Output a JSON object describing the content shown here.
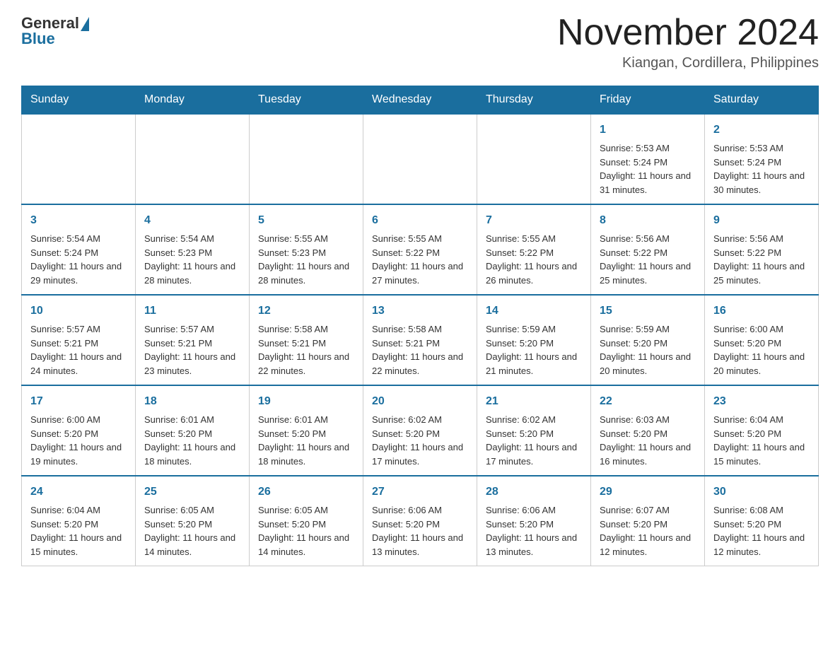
{
  "header": {
    "logo": {
      "general": "General",
      "blue": "Blue"
    },
    "title": "November 2024",
    "location": "Kiangan, Cordillera, Philippines"
  },
  "days_of_week": [
    "Sunday",
    "Monday",
    "Tuesday",
    "Wednesday",
    "Thursday",
    "Friday",
    "Saturday"
  ],
  "weeks": [
    [
      {
        "day": "",
        "info": ""
      },
      {
        "day": "",
        "info": ""
      },
      {
        "day": "",
        "info": ""
      },
      {
        "day": "",
        "info": ""
      },
      {
        "day": "",
        "info": ""
      },
      {
        "day": "1",
        "info": "Sunrise: 5:53 AM\nSunset: 5:24 PM\nDaylight: 11 hours and 31 minutes."
      },
      {
        "day": "2",
        "info": "Sunrise: 5:53 AM\nSunset: 5:24 PM\nDaylight: 11 hours and 30 minutes."
      }
    ],
    [
      {
        "day": "3",
        "info": "Sunrise: 5:54 AM\nSunset: 5:24 PM\nDaylight: 11 hours and 29 minutes."
      },
      {
        "day": "4",
        "info": "Sunrise: 5:54 AM\nSunset: 5:23 PM\nDaylight: 11 hours and 28 minutes."
      },
      {
        "day": "5",
        "info": "Sunrise: 5:55 AM\nSunset: 5:23 PM\nDaylight: 11 hours and 28 minutes."
      },
      {
        "day": "6",
        "info": "Sunrise: 5:55 AM\nSunset: 5:22 PM\nDaylight: 11 hours and 27 minutes."
      },
      {
        "day": "7",
        "info": "Sunrise: 5:55 AM\nSunset: 5:22 PM\nDaylight: 11 hours and 26 minutes."
      },
      {
        "day": "8",
        "info": "Sunrise: 5:56 AM\nSunset: 5:22 PM\nDaylight: 11 hours and 25 minutes."
      },
      {
        "day": "9",
        "info": "Sunrise: 5:56 AM\nSunset: 5:22 PM\nDaylight: 11 hours and 25 minutes."
      }
    ],
    [
      {
        "day": "10",
        "info": "Sunrise: 5:57 AM\nSunset: 5:21 PM\nDaylight: 11 hours and 24 minutes."
      },
      {
        "day": "11",
        "info": "Sunrise: 5:57 AM\nSunset: 5:21 PM\nDaylight: 11 hours and 23 minutes."
      },
      {
        "day": "12",
        "info": "Sunrise: 5:58 AM\nSunset: 5:21 PM\nDaylight: 11 hours and 22 minutes."
      },
      {
        "day": "13",
        "info": "Sunrise: 5:58 AM\nSunset: 5:21 PM\nDaylight: 11 hours and 22 minutes."
      },
      {
        "day": "14",
        "info": "Sunrise: 5:59 AM\nSunset: 5:20 PM\nDaylight: 11 hours and 21 minutes."
      },
      {
        "day": "15",
        "info": "Sunrise: 5:59 AM\nSunset: 5:20 PM\nDaylight: 11 hours and 20 minutes."
      },
      {
        "day": "16",
        "info": "Sunrise: 6:00 AM\nSunset: 5:20 PM\nDaylight: 11 hours and 20 minutes."
      }
    ],
    [
      {
        "day": "17",
        "info": "Sunrise: 6:00 AM\nSunset: 5:20 PM\nDaylight: 11 hours and 19 minutes."
      },
      {
        "day": "18",
        "info": "Sunrise: 6:01 AM\nSunset: 5:20 PM\nDaylight: 11 hours and 18 minutes."
      },
      {
        "day": "19",
        "info": "Sunrise: 6:01 AM\nSunset: 5:20 PM\nDaylight: 11 hours and 18 minutes."
      },
      {
        "day": "20",
        "info": "Sunrise: 6:02 AM\nSunset: 5:20 PM\nDaylight: 11 hours and 17 minutes."
      },
      {
        "day": "21",
        "info": "Sunrise: 6:02 AM\nSunset: 5:20 PM\nDaylight: 11 hours and 17 minutes."
      },
      {
        "day": "22",
        "info": "Sunrise: 6:03 AM\nSunset: 5:20 PM\nDaylight: 11 hours and 16 minutes."
      },
      {
        "day": "23",
        "info": "Sunrise: 6:04 AM\nSunset: 5:20 PM\nDaylight: 11 hours and 15 minutes."
      }
    ],
    [
      {
        "day": "24",
        "info": "Sunrise: 6:04 AM\nSunset: 5:20 PM\nDaylight: 11 hours and 15 minutes."
      },
      {
        "day": "25",
        "info": "Sunrise: 6:05 AM\nSunset: 5:20 PM\nDaylight: 11 hours and 14 minutes."
      },
      {
        "day": "26",
        "info": "Sunrise: 6:05 AM\nSunset: 5:20 PM\nDaylight: 11 hours and 14 minutes."
      },
      {
        "day": "27",
        "info": "Sunrise: 6:06 AM\nSunset: 5:20 PM\nDaylight: 11 hours and 13 minutes."
      },
      {
        "day": "28",
        "info": "Sunrise: 6:06 AM\nSunset: 5:20 PM\nDaylight: 11 hours and 13 minutes."
      },
      {
        "day": "29",
        "info": "Sunrise: 6:07 AM\nSunset: 5:20 PM\nDaylight: 11 hours and 12 minutes."
      },
      {
        "day": "30",
        "info": "Sunrise: 6:08 AM\nSunset: 5:20 PM\nDaylight: 11 hours and 12 minutes."
      }
    ]
  ],
  "accent_color": "#1a6e9e"
}
